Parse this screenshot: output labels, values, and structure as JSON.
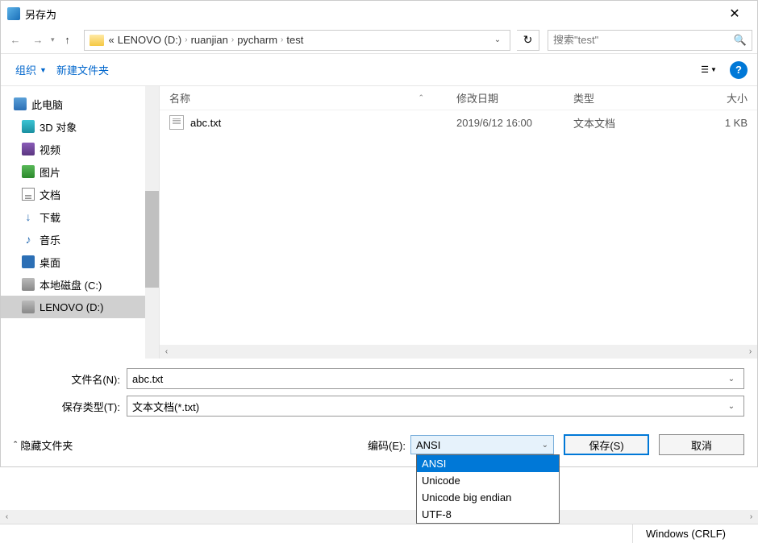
{
  "title": "另存为",
  "breadcrumb_prefix": "«",
  "breadcrumbs": [
    "LENOVO (D:)",
    "ruanjian",
    "pycharm",
    "test"
  ],
  "search_placeholder": "搜索\"test\"",
  "toolbar": {
    "organize": "组织",
    "new_folder": "新建文件夹"
  },
  "sidebar": {
    "this_pc": "此电脑",
    "items": [
      {
        "label": "3D 对象",
        "icon": "ic-3d"
      },
      {
        "label": "视频",
        "icon": "ic-video"
      },
      {
        "label": "图片",
        "icon": "ic-pic"
      },
      {
        "label": "文档",
        "icon": "ic-doc"
      },
      {
        "label": "下载",
        "icon": "ic-dl",
        "glyph": "↓"
      },
      {
        "label": "音乐",
        "icon": "ic-music",
        "glyph": "♪"
      },
      {
        "label": "桌面",
        "icon": "ic-desk"
      },
      {
        "label": "本地磁盘 (C:)",
        "icon": "ic-disk"
      },
      {
        "label": "LENOVO (D:)",
        "icon": "ic-disk",
        "selected": true
      }
    ]
  },
  "columns": {
    "name": "名称",
    "date": "修改日期",
    "type": "类型",
    "size": "大小"
  },
  "files": [
    {
      "name": "abc.txt",
      "date": "2019/6/12 16:00",
      "type": "文本文档",
      "size": "1 KB"
    }
  ],
  "form": {
    "filename_label": "文件名(N):",
    "filename_value": "abc.txt",
    "savetype_label": "保存类型(T):",
    "savetype_value": "文本文档(*.txt)",
    "encoding_label": "编码(E):",
    "encoding_value": "ANSI",
    "encoding_options": [
      "ANSI",
      "Unicode",
      "Unicode big endian",
      "UTF-8"
    ],
    "hide_folders": "隐藏文件夹",
    "save": "保存(S)",
    "cancel": "取消"
  },
  "status": {
    "line_ending": "Windows (CRLF)"
  }
}
